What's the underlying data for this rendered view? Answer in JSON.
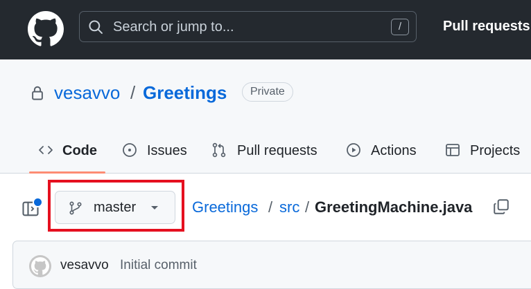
{
  "header": {
    "search_placeholder": "Search or jump to...",
    "search_shortcut": "/",
    "pull_requests_label": "Pull requests"
  },
  "repo": {
    "owner": "vesavvo",
    "separator": "/",
    "name": "Greetings",
    "visibility": "Private"
  },
  "tabs": [
    {
      "label": "Code",
      "icon": "code-icon",
      "selected": true
    },
    {
      "label": "Issues",
      "icon": "issue-icon",
      "selected": false
    },
    {
      "label": "Pull requests",
      "icon": "pull-request-icon",
      "selected": false
    },
    {
      "label": "Actions",
      "icon": "play-icon",
      "selected": false
    },
    {
      "label": "Projects",
      "icon": "table-icon",
      "selected": false
    }
  ],
  "file_nav": {
    "branch": "master",
    "breadcrumb": {
      "repo": "Greetings",
      "sep": "/",
      "folder": "src",
      "file": "GreetingMachine.java"
    }
  },
  "commit": {
    "author": "vesavvo",
    "message": "Initial commit"
  },
  "colors": {
    "header_bg": "#24292f",
    "link": "#0969da",
    "tab_underline": "#fd8c73",
    "highlight": "#e5101f"
  }
}
